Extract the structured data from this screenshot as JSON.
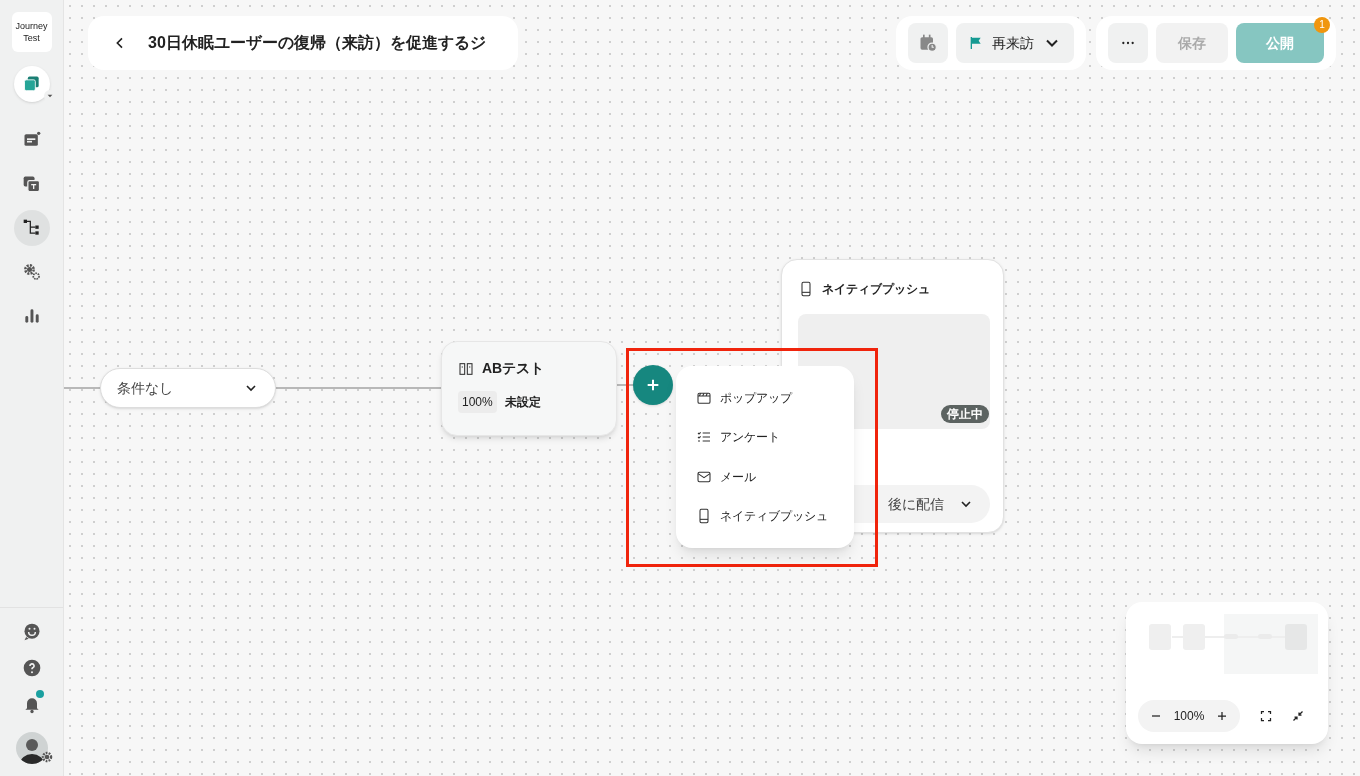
{
  "sidebar": {
    "logo": [
      "Journey",
      "Test"
    ],
    "nav": [
      {
        "selected": false
      },
      {
        "selected": false
      },
      {
        "selected": true
      },
      {
        "selected": false
      },
      {
        "selected": false
      }
    ],
    "bell": {
      "unread": true
    }
  },
  "header": {
    "title": "30日休眠ユーザーの復帰（来訪）を促進するジ",
    "goal": "再来訪",
    "save": {
      "label": "保存",
      "disabled": true
    },
    "publish": {
      "label": "公開",
      "disabled": true,
      "badge": "1"
    }
  },
  "canvas": {
    "condition": "条件なし",
    "ab_node": {
      "title": "ABテスト",
      "split": "100%",
      "status": "未設定"
    },
    "add_menu": [
      {
        "kind": "popup",
        "label": "ポップアップ"
      },
      {
        "kind": "survey",
        "label": "アンケート"
      },
      {
        "kind": "mail",
        "label": "メール"
      },
      {
        "kind": "push",
        "label": "ネイティブプッシュ"
      }
    ],
    "push_node": {
      "title": "ネイティブプッシュ",
      "status": "停止中",
      "schedule": "後に配信"
    },
    "zoom": "100%"
  }
}
